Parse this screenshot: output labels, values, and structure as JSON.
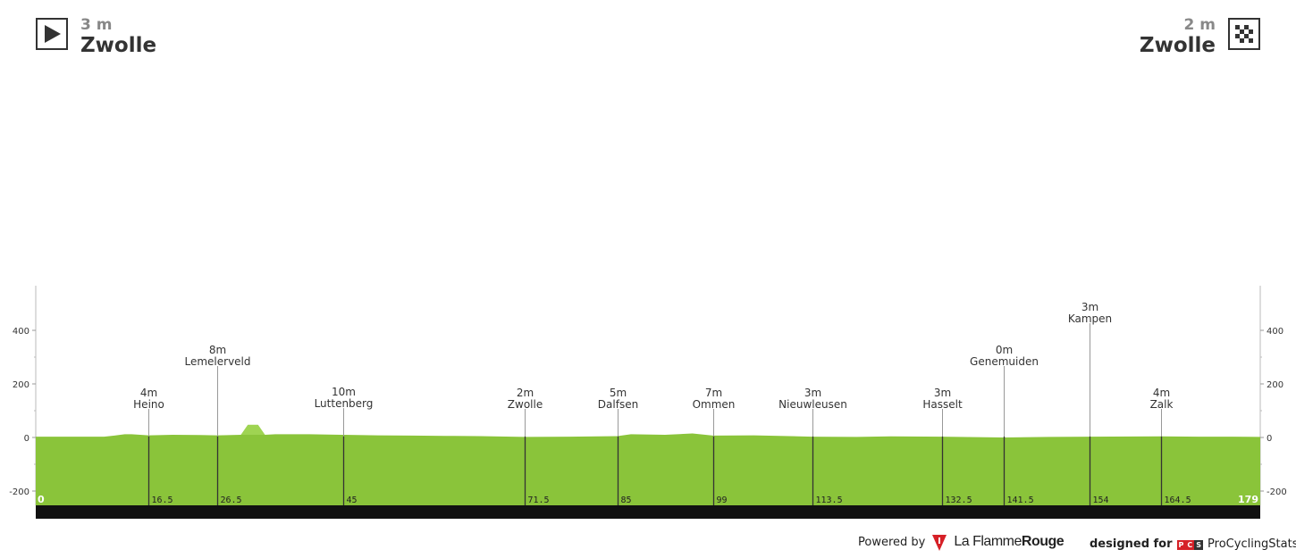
{
  "header": {
    "start": {
      "elevation": "3 m",
      "town": "Zwolle",
      "icon": "play-icon"
    },
    "finish": {
      "elevation": "2 m",
      "town": "Zwolle",
      "icon": "checkered-flag-icon"
    }
  },
  "chart_data": {
    "type": "area",
    "title": "",
    "xlabel": "",
    "ylabel": "",
    "xlim": [
      0,
      179
    ],
    "ylim": [
      -250,
      560
    ],
    "y_ticks": [
      -200,
      0,
      200,
      400
    ],
    "y_tick_labels": [
      "-200",
      "0",
      "200",
      "400"
    ],
    "fill_color": "#8ac43a",
    "climb_color": "#9fd452",
    "distance_start_label": "0",
    "distance_end_label": "179",
    "profile": {
      "x": [
        0,
        10,
        11.5,
        13,
        14,
        16.5,
        20,
        24,
        26.5,
        30,
        31,
        32.5,
        33.5,
        35,
        40,
        45,
        50,
        55,
        60,
        65,
        71.5,
        78,
        85,
        87,
        92,
        96,
        99,
        105,
        113.5,
        120,
        125,
        132.5,
        141.5,
        148,
        154,
        164.5,
        170,
        175,
        179
      ],
      "y": [
        3,
        3,
        7,
        12,
        12,
        8,
        10,
        9,
        8,
        10,
        47,
        47,
        10,
        12,
        12,
        10,
        8,
        7,
        6,
        5,
        2,
        3,
        5,
        12,
        10,
        15,
        7,
        8,
        3,
        2,
        4,
        3,
        0,
        2,
        3,
        4,
        3,
        3,
        2
      ]
    },
    "waypoints": [
      {
        "km": 16.5,
        "km_label": "16.5",
        "elevation": "4m",
        "name": "Heino",
        "label_height": 140
      },
      {
        "km": 26.5,
        "km_label": "26.5",
        "elevation": "8m",
        "name": "Lemelerveld",
        "label_height": 300
      },
      {
        "km": 45,
        "km_label": "45",
        "elevation": "10m",
        "name": "Luttenberg",
        "label_height": 143
      },
      {
        "km": 71.5,
        "km_label": "71.5",
        "elevation": "2m",
        "name": "Zwolle",
        "label_height": 140
      },
      {
        "km": 85,
        "km_label": "85",
        "elevation": "5m",
        "name": "Dalfsen",
        "label_height": 140
      },
      {
        "km": 99,
        "km_label": "99",
        "elevation": "7m",
        "name": "Ommen",
        "label_height": 140
      },
      {
        "km": 113.5,
        "km_label": "113.5",
        "elevation": "3m",
        "name": "Nieuwleusen",
        "label_height": 140
      },
      {
        "km": 132.5,
        "km_label": "132.5",
        "elevation": "3m",
        "name": "Hasselt",
        "label_height": 140
      },
      {
        "km": 141.5,
        "km_label": "141.5",
        "elevation": "0m",
        "name": "Genemuiden",
        "label_height": 300
      },
      {
        "km": 154,
        "km_label": "154",
        "elevation": "3m",
        "name": "Kampen",
        "label_height": 460
      },
      {
        "km": 164.5,
        "km_label": "164.5",
        "elevation": "4m",
        "name": "Zalk",
        "label_height": 140
      }
    ]
  },
  "footer": {
    "powered_by": "Powered by",
    "lfr_brand_light": "La Flamme",
    "lfr_brand_bold": "Rouge",
    "designed_for": "designed for",
    "pcs_letters": [
      "P",
      "C",
      "S"
    ],
    "pcs_name": "ProCyclingStats"
  }
}
